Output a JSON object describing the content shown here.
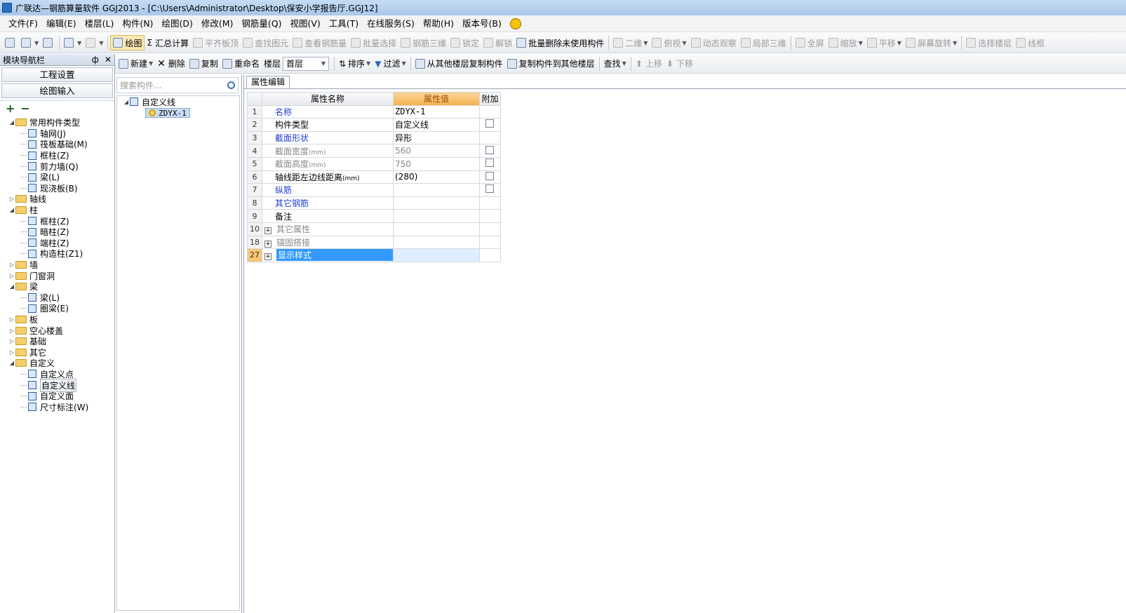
{
  "title": "广联达—钢筋算量软件 GGJ2013 - [C:\\Users\\Administrator\\Desktop\\保安小学报告厅.GGJ12]",
  "menu": [
    "文件(F)",
    "编辑(E)",
    "楼层(L)",
    "构件(N)",
    "绘图(D)",
    "修改(M)",
    "钢筋量(Q)",
    "视图(V)",
    "工具(T)",
    "在线服务(S)",
    "帮助(H)",
    "版本号(B)"
  ],
  "toolbar": {
    "draw": "绘图",
    "sum": "汇总计算",
    "flush": "平齐板顶",
    "find": "查找图元",
    "view_rebar": "查看钢筋量",
    "batch_select": "批量选择",
    "rebar_3d": "钢筋三维",
    "lock": "锁定",
    "unlock": "解锁",
    "batch_delete": "批量删除未使用构件",
    "two_d": "二维",
    "top_view": "俯视",
    "dynamic": "动态观察",
    "local_3d": "局部三维",
    "fullscreen": "全屏",
    "zoom": "缩放",
    "pan": "平移",
    "rotate": "屏幕旋转",
    "select_floor": "选择楼层",
    "wireframe": "线框"
  },
  "nav": {
    "header": "模块导航栏",
    "pin": "ф",
    "close": "✕",
    "btn_project": "工程设置",
    "btn_draw": "绘图输入"
  },
  "tree": [
    {
      "label": "常用构件类型",
      "level": 0,
      "type": "folder",
      "exp": "◢"
    },
    {
      "label": "轴网(J)",
      "level": 1,
      "type": "item"
    },
    {
      "label": "筏板基础(M)",
      "level": 1,
      "type": "item"
    },
    {
      "label": "框柱(Z)",
      "level": 1,
      "type": "item"
    },
    {
      "label": "剪力墙(Q)",
      "level": 1,
      "type": "item"
    },
    {
      "label": "梁(L)",
      "level": 1,
      "type": "item"
    },
    {
      "label": "现浇板(B)",
      "level": 1,
      "type": "item"
    },
    {
      "label": "轴线",
      "level": 0,
      "type": "folder",
      "exp": "▷"
    },
    {
      "label": "柱",
      "level": 0,
      "type": "folder",
      "exp": "◢"
    },
    {
      "label": "框柱(Z)",
      "level": 1,
      "type": "item"
    },
    {
      "label": "暗柱(Z)",
      "level": 1,
      "type": "item"
    },
    {
      "label": "端柱(Z)",
      "level": 1,
      "type": "item"
    },
    {
      "label": "构造柱(Z1)",
      "level": 1,
      "type": "item"
    },
    {
      "label": "墙",
      "level": 0,
      "type": "folder",
      "exp": "▷"
    },
    {
      "label": "门窗洞",
      "level": 0,
      "type": "folder",
      "exp": "▷"
    },
    {
      "label": "梁",
      "level": 0,
      "type": "folder",
      "exp": "◢"
    },
    {
      "label": "梁(L)",
      "level": 1,
      "type": "item"
    },
    {
      "label": "圈梁(E)",
      "level": 1,
      "type": "item"
    },
    {
      "label": "板",
      "level": 0,
      "type": "folder",
      "exp": "▷"
    },
    {
      "label": "空心楼盖",
      "level": 0,
      "type": "folder",
      "exp": "▷"
    },
    {
      "label": "基础",
      "level": 0,
      "type": "folder",
      "exp": "▷"
    },
    {
      "label": "其它",
      "level": 0,
      "type": "folder",
      "exp": "▷"
    },
    {
      "label": "自定义",
      "level": 0,
      "type": "folder",
      "exp": "◢"
    },
    {
      "label": "自定义点",
      "level": 1,
      "type": "item"
    },
    {
      "label": "自定义线",
      "level": 1,
      "type": "item",
      "selected": true
    },
    {
      "label": "自定义面",
      "level": 1,
      "type": "item"
    },
    {
      "label": "尺寸标注(W)",
      "level": 1,
      "type": "item"
    }
  ],
  "comp_toolbar": {
    "new": "新建",
    "delete": "删除",
    "copy": "复制",
    "rename": "重命名",
    "floor_label": "楼层",
    "floor_value": "首层",
    "sort": "排序",
    "filter": "过滤",
    "copy_from": "从其他楼层复制构件",
    "copy_to": "复制构件到其他楼层",
    "find": "查找",
    "up": "上移",
    "down": "下移"
  },
  "search": {
    "placeholder": "搜索构件..."
  },
  "comp_tree": {
    "root": "自定义线",
    "child": "ZDYX-1"
  },
  "prop": {
    "tab": "属性编辑",
    "headers": {
      "name": "属性名称",
      "value": "属性值",
      "extra": "附加"
    },
    "rows": [
      {
        "no": "1",
        "name": "名称",
        "value": "ZDYX-1",
        "check": false,
        "style": "blue",
        "mono": true
      },
      {
        "no": "2",
        "name": "构件类型",
        "value": "自定义线",
        "check": true,
        "style": ""
      },
      {
        "no": "3",
        "name": "截面形状",
        "value": "异形",
        "check": false,
        "style": "blue"
      },
      {
        "no": "4",
        "name": "截面宽度",
        "unit": "(mm)",
        "value": "560",
        "check": true,
        "style": "gray"
      },
      {
        "no": "5",
        "name": "截面高度",
        "unit": "(mm)",
        "value": "750",
        "check": true,
        "style": "gray"
      },
      {
        "no": "6",
        "name": "轴线距左边线距离",
        "unit": "(mm)",
        "value": "(280)",
        "check": true,
        "style": ""
      },
      {
        "no": "7",
        "name": "纵筋",
        "value": "",
        "check": true,
        "style": "blue"
      },
      {
        "no": "8",
        "name": "其它钢筋",
        "value": "",
        "check": false,
        "style": "blue"
      },
      {
        "no": "9",
        "name": "备注",
        "value": "",
        "check": false,
        "style": ""
      },
      {
        "no": "10",
        "name": "其它属性",
        "value": "",
        "check": false,
        "style": "gray",
        "plus": true
      },
      {
        "no": "18",
        "name": "锚固搭接",
        "value": "",
        "check": false,
        "style": "gray",
        "plus": true
      },
      {
        "no": "27",
        "name": "显示样式",
        "value": "",
        "check": false,
        "style": "hl",
        "plus": true
      }
    ]
  }
}
